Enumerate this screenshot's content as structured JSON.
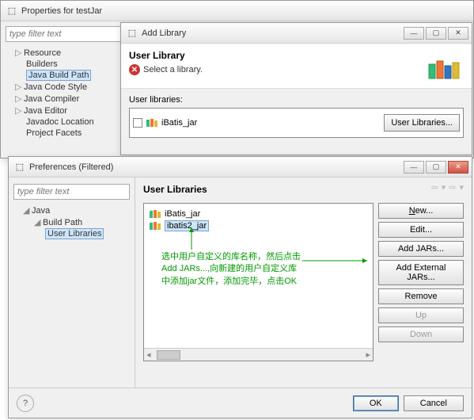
{
  "properties_window": {
    "title": "Properties for testJar",
    "filter_placeholder": "type filter text",
    "tree": {
      "items": [
        {
          "label": "Resource",
          "expandable": true
        },
        {
          "label": "Builders"
        },
        {
          "label": "Java Build Path",
          "selected": true
        },
        {
          "label": "Java Code Style",
          "expandable": true
        },
        {
          "label": "Java Compiler",
          "expandable": true
        },
        {
          "label": "Java Editor",
          "expandable": true
        },
        {
          "label": "Javadoc Location"
        },
        {
          "label": "Project Facets"
        }
      ]
    }
  },
  "addlib_window": {
    "title": "Add Library",
    "heading": "User Library",
    "error_text": "Select a library.",
    "list_label": "User libraries:",
    "list_items": [
      "iBatis_jar"
    ],
    "user_libraries_btn": "User Libraries..."
  },
  "prefs_window": {
    "title": "Preferences (Filtered)",
    "filter_placeholder": "type filter text",
    "tree": {
      "root": "Java",
      "child": "Build Path",
      "leaf": "User Libraries"
    },
    "heading": "User Libraries",
    "lib_items": [
      {
        "name": "iBatis_jar",
        "selected": false
      },
      {
        "name": "ibatis2_jar",
        "selected": true
      }
    ],
    "buttons": {
      "new": "New...",
      "edit": "Edit...",
      "add_jars": "Add JARs...",
      "add_ext": "Add External JARs...",
      "remove": "Remove",
      "up": "Up",
      "down": "Down"
    },
    "footer": {
      "ok": "OK",
      "cancel": "Cancel"
    }
  },
  "annotation_text": "选中用户自定义的库名称，然后点击\nAdd JARs...,向新建的用户自定义库\n中添加jar文件，添加完毕，点击OK"
}
